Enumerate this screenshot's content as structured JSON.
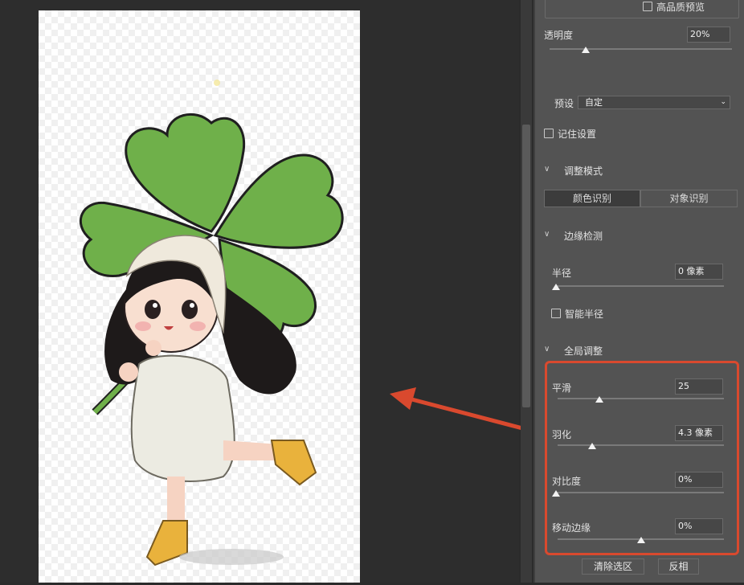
{
  "panel": {
    "hq_preview_label": "高品质预览",
    "opacity_label": "透明度",
    "opacity_value": "20%",
    "opacity_level": 0.2,
    "preset_label": "预设",
    "preset_value": "自定",
    "remember_label": "记住设置",
    "adjust_mode": {
      "title": "调整模式",
      "color_btn": "颜色识别",
      "object_btn": "对象识别"
    },
    "edge_detect": {
      "title": "边缘检测",
      "radius_label": "半径",
      "radius_value": "0 像素",
      "radius_level": 0.0,
      "smart_radius_label": "智能半径"
    },
    "global": {
      "title": "全局调整",
      "smooth_label": "平滑",
      "smooth_value": "25",
      "smooth_level": 0.25,
      "feather_label": "羽化",
      "feather_value": "4.3 像素",
      "feather_level": 0.21,
      "contrast_label": "对比度",
      "contrast_value": "0%",
      "contrast_level": 0.0,
      "shift_label": "移动边缘",
      "shift_value": "0%",
      "shift_level": 0.5
    },
    "clear_btn": "清除选区",
    "invert_btn": "反相"
  },
  "colors": {
    "annotation": "#d9492e",
    "panel_bg": "#535353",
    "canvas_bg": "#2d2d2d"
  }
}
